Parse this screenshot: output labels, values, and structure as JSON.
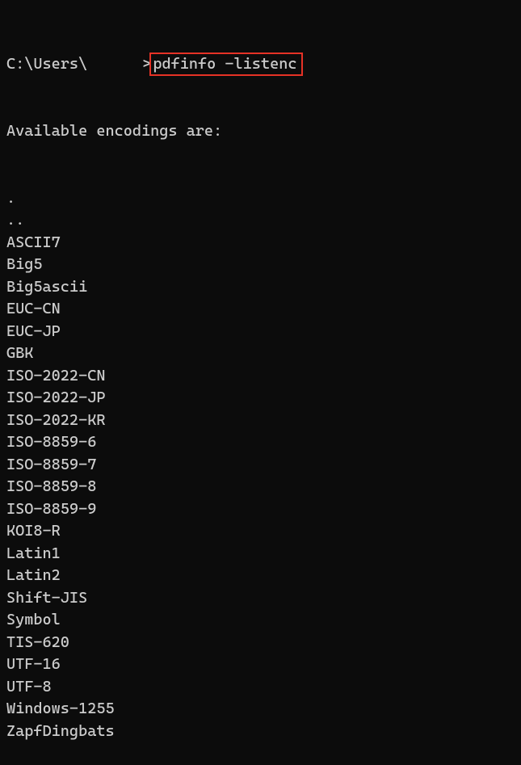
{
  "prompt": {
    "prefix": "C:\\Users\\",
    "gt": ">",
    "command": "pdfinfo -listenc"
  },
  "output": {
    "header": "Available encodings are:",
    "encodings": [
      ".",
      "..",
      "ASCII7",
      "Big5",
      "Big5ascii",
      "EUC-CN",
      "EUC-JP",
      "GBK",
      "ISO-2022-CN",
      "ISO-2022-JP",
      "ISO-2022-KR",
      "ISO-8859-6",
      "ISO-8859-7",
      "ISO-8859-8",
      "ISO-8859-9",
      "KOI8-R",
      "Latin1",
      "Latin2",
      "Shift-JIS",
      "Symbol",
      "TIS-620",
      "UTF-16",
      "UTF-8",
      "Windows-1255",
      "ZapfDingbats"
    ]
  },
  "highlight_color": "#e63226"
}
